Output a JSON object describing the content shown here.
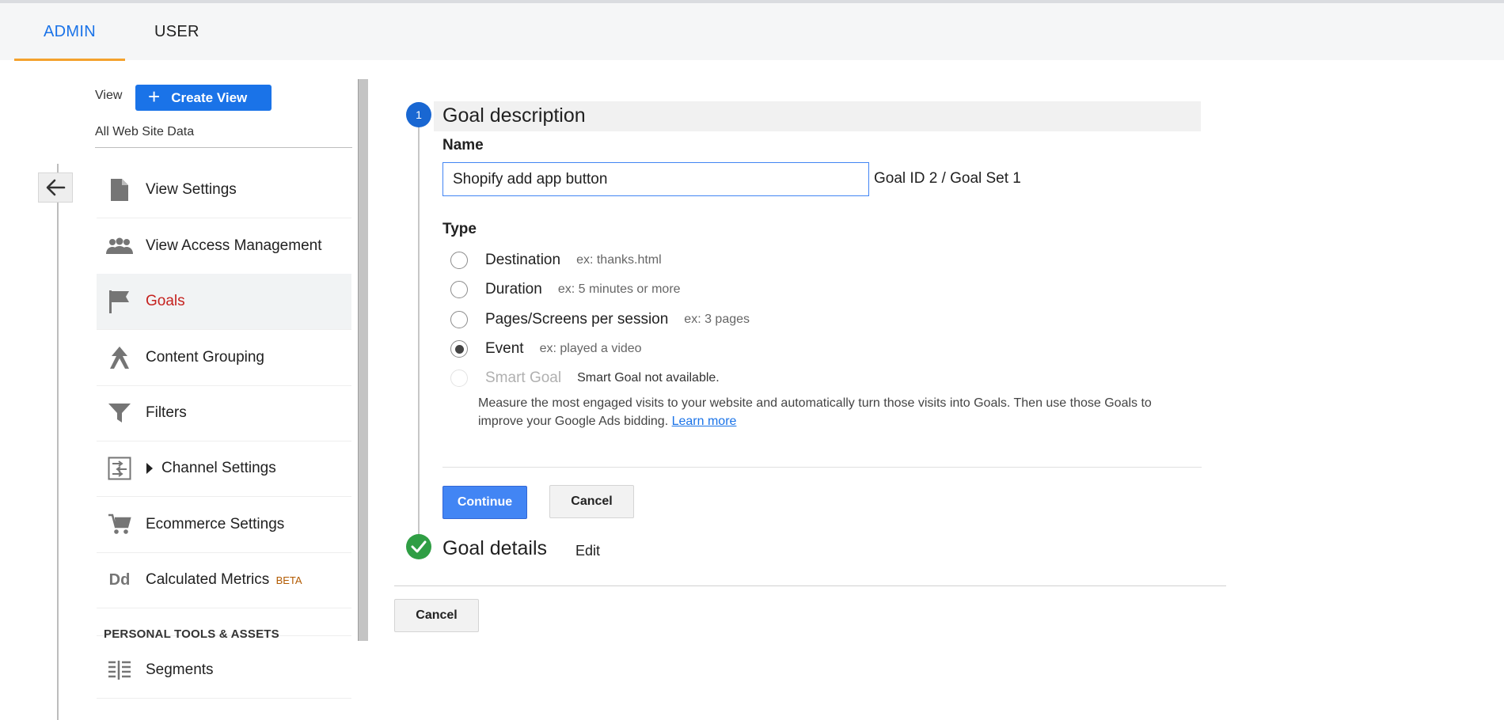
{
  "tabs": [
    {
      "label": "ADMIN",
      "active": true
    },
    {
      "label": "USER",
      "active": false
    }
  ],
  "sidebar": {
    "view_label": "View",
    "create_view_label": "Create View",
    "selected_view": "All Web Site Data",
    "items": [
      {
        "label": "View Settings",
        "icon": "document-icon"
      },
      {
        "label": "View Access Management",
        "icon": "people-icon"
      },
      {
        "label": "Goals",
        "icon": "flag-icon",
        "active": true
      },
      {
        "label": "Content Grouping",
        "icon": "content-grouping-icon"
      },
      {
        "label": "Filters",
        "icon": "filter-icon"
      },
      {
        "label": "Channel Settings",
        "icon": "channel-settings-icon"
      },
      {
        "label": "Ecommerce Settings",
        "icon": "cart-icon"
      },
      {
        "label": "Calculated Metrics",
        "badge": "BETA",
        "icon": "dd-icon"
      },
      {
        "label": "Segments",
        "icon": "segments-icon"
      }
    ],
    "section_heading": "PERSONAL TOOLS & ASSETS",
    "dd_icon_text": "Dd"
  },
  "goal": {
    "step_number": "1",
    "step_title": "Goal description",
    "name_label": "Name",
    "name_value": "Shopify add app button",
    "goal_id_text": "Goal ID 2 / Goal Set 1",
    "type_label": "Type",
    "types": [
      {
        "label": "Destination",
        "example": "ex: thanks.html",
        "selected": false
      },
      {
        "label": "Duration",
        "example": "ex: 5 minutes or more",
        "selected": false
      },
      {
        "label": "Pages/Screens per session",
        "example": "ex: 3 pages",
        "selected": false
      },
      {
        "label": "Event",
        "example": "ex: played a video",
        "selected": true
      },
      {
        "label": "Smart Goal",
        "example": "Smart Goal not available.",
        "selected": false,
        "disabled": true
      }
    ],
    "smart_desc": "Measure the most engaged visits to your website and automatically turn those visits into Goals. Then use those Goals to improve your Google Ads bidding.",
    "learn_more": "Learn more",
    "continue_label": "Continue",
    "cancel_label": "Cancel",
    "details_title": "Goal details",
    "edit_label": "Edit",
    "bottom_cancel_label": "Cancel"
  },
  "colors": {
    "accent_blue": "#1a73e8",
    "tab_underline": "#f4a22d",
    "active_nav_text": "#c5221f",
    "step_done_green": "#2f9e44"
  }
}
